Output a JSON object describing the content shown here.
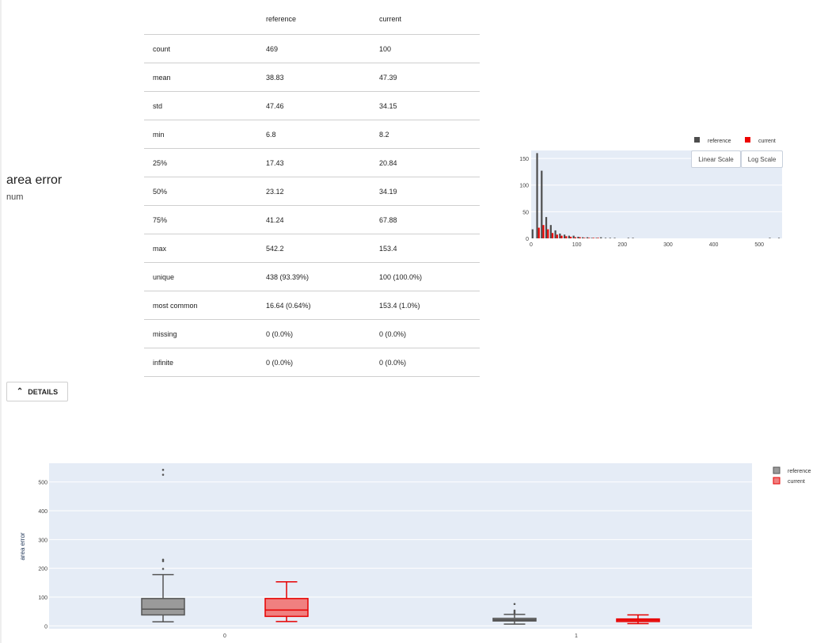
{
  "feature": {
    "name": "area error",
    "type": "num"
  },
  "table": {
    "headers": [
      "",
      "reference",
      "current"
    ],
    "rows": [
      [
        "count",
        "469",
        "100"
      ],
      [
        "mean",
        "38.83",
        "47.39"
      ],
      [
        "std",
        "47.46",
        "34.15"
      ],
      [
        "min",
        "6.8",
        "8.2"
      ],
      [
        "25%",
        "17.43",
        "20.84"
      ],
      [
        "50%",
        "23.12",
        "34.19"
      ],
      [
        "75%",
        "41.24",
        "67.88"
      ],
      [
        "max",
        "542.2",
        "153.4"
      ],
      [
        "unique",
        "438 (93.39%)",
        "100 (100.0%)"
      ],
      [
        "most common",
        "16.64 (0.64%)",
        "153.4 (1.0%)"
      ],
      [
        "missing",
        "0 (0.0%)",
        "0 (0.0%)"
      ],
      [
        "infinite",
        "0 (0.0%)",
        "0 (0.0%)"
      ]
    ]
  },
  "details_button": {
    "label": "DETAILS",
    "icon": "chevron-up-icon"
  },
  "colors": {
    "reference": "#4d4d4d",
    "current": "#ed0400",
    "plot_bg": "#e5ecf6",
    "ref_fill": "#9a9a9a",
    "cur_fill": "#f08080"
  },
  "chart_data": [
    {
      "type": "bar",
      "xlim": [
        0,
        550
      ],
      "ylim": [
        0,
        165
      ],
      "x_ticks": [
        "0",
        "100",
        "200",
        "300",
        "400",
        "500"
      ],
      "y_ticks": [
        "0",
        "50",
        "100",
        "150"
      ],
      "legend": [
        "reference",
        "current"
      ],
      "legend_position": "top-right",
      "buttons": [
        "Linear Scale",
        "Log Scale"
      ],
      "series": [
        {
          "name": "reference",
          "bins": [
            5,
            15,
            25,
            35,
            45,
            55,
            65,
            75,
            85,
            95,
            105,
            115,
            125,
            135,
            145,
            155,
            165,
            175,
            185,
            215,
            225,
            525,
            545
          ],
          "values": [
            17,
            160,
            127,
            40,
            25,
            15,
            9,
            7,
            5,
            5,
            3,
            2,
            2,
            1,
            1,
            2,
            1,
            1,
            1,
            1,
            1,
            1,
            1
          ]
        },
        {
          "name": "current",
          "bins": [
            15,
            25,
            35,
            45,
            55,
            65,
            75,
            85,
            95,
            105,
            115,
            125,
            135,
            145
          ],
          "values": [
            20,
            25,
            17,
            10,
            7,
            5,
            4,
            3,
            2,
            2,
            1,
            1,
            1,
            1
          ]
        }
      ]
    },
    {
      "type": "box",
      "ylabel": "area error",
      "ylim": [
        -10,
        565
      ],
      "categories": [
        "0",
        "1"
      ],
      "y_ticks": [
        "0",
        "100",
        "200",
        "300",
        "400",
        "500"
      ],
      "legend": [
        "reference",
        "current"
      ],
      "legend_position": "top-right",
      "series": [
        {
          "name": "reference",
          "boxes": [
            {
              "category": "0",
              "min": 14,
              "q1": 38,
              "median": 58,
              "q3": 95,
              "max": 178,
              "outliers": [
                198,
                225,
                230,
                525,
                542
              ]
            },
            {
              "category": "1",
              "min": 6,
              "q1": 17,
              "median": 21,
              "q3": 26,
              "max": 40,
              "outliers": [
                44,
                48,
                53,
                76
              ]
            }
          ]
        },
        {
          "name": "current",
          "boxes": [
            {
              "category": "0",
              "min": 15,
              "q1": 33,
              "median": 55,
              "q3": 95,
              "max": 153
            },
            {
              "category": "1",
              "min": 8,
              "q1": 15,
              "median": 20,
              "q3": 24,
              "max": 38
            }
          ]
        }
      ]
    }
  ]
}
